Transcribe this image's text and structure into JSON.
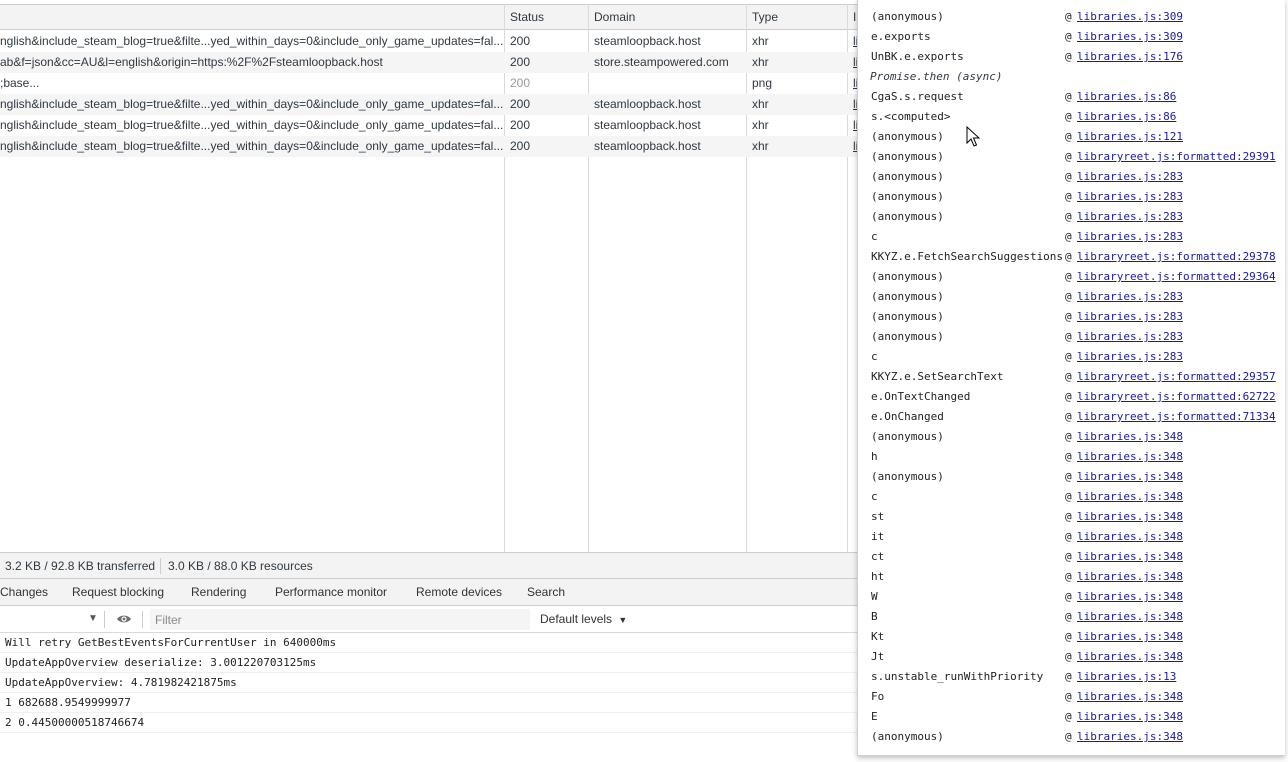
{
  "network": {
    "columns": {
      "status": "Status",
      "domain": "Domain",
      "type": "Type",
      "initiator": "I"
    },
    "rows": [
      {
        "name": "nglish&include_steam_blog=true&filte...yed_within_days=0&include_only_game_updates=fal...",
        "status": "200",
        "domain": "steamloopback.host",
        "type": "xhr",
        "initiator": "li",
        "dim": false
      },
      {
        "name": "ab&f=json&cc=AU&l=english&origin=https:%2F%2Fsteamloopback.host",
        "status": "200",
        "domain": "store.steampowered.com",
        "type": "xhr",
        "initiator": "li",
        "dim": false
      },
      {
        "name": ";base...",
        "status": "200",
        "domain": "",
        "type": "png",
        "initiator": "li",
        "dim": true
      },
      {
        "name": "nglish&include_steam_blog=true&filte...yed_within_days=0&include_only_game_updates=fal...",
        "status": "200",
        "domain": "steamloopback.host",
        "type": "xhr",
        "initiator": "li",
        "dim": false
      },
      {
        "name": "nglish&include_steam_blog=true&filte...yed_within_days=0&include_only_game_updates=fal...",
        "status": "200",
        "domain": "steamloopback.host",
        "type": "xhr",
        "initiator": "li",
        "dim": false
      },
      {
        "name": "nglish&include_steam_blog=true&filte...yed_within_days=0&include_only_game_updates=fal...",
        "status": "200",
        "domain": "steamloopback.host",
        "type": "xhr",
        "initiator": "li",
        "dim": false
      }
    ]
  },
  "summary": {
    "transferred": "3.2 KB / 92.8 KB transferred",
    "resources": "3.0 KB / 88.0 KB resources"
  },
  "drawer_tabs": [
    "Changes",
    "Request blocking",
    "Rendering",
    "Performance monitor",
    "Remote devices",
    "Search"
  ],
  "console": {
    "filter_placeholder": "Filter",
    "levels_label": "Default levels",
    "messages": [
      "Will retry GetBestEventsForCurrentUser in 640000ms",
      "UpdateAppOverview deserialize: 3.001220703125ms",
      "UpdateAppOverview: 4.781982421875ms",
      "1 682688.9549999977",
      "2 0.44500000518746674"
    ]
  },
  "call_stack": {
    "at_symbol": "@",
    "frames": [
      {
        "fn": "(anonymous)",
        "loc": "libraries.js:309"
      },
      {
        "fn": "e.exports",
        "loc": "libraries.js:309"
      },
      {
        "fn": "UnBK.e.exports",
        "loc": "libraries.js:176"
      },
      {
        "async": "Promise.then (async)"
      },
      {
        "fn": "CgaS.s.request",
        "loc": "libraries.js:86"
      },
      {
        "fn": "s.<computed>",
        "loc": "libraries.js:86"
      },
      {
        "fn": "(anonymous)",
        "loc": "libraries.js:121"
      },
      {
        "fn": "(anonymous)",
        "loc": "libraryreet.js:formatted:29391"
      },
      {
        "fn": "(anonymous)",
        "loc": "libraries.js:283"
      },
      {
        "fn": "(anonymous)",
        "loc": "libraries.js:283"
      },
      {
        "fn": "(anonymous)",
        "loc": "libraries.js:283"
      },
      {
        "fn": "c",
        "loc": "libraries.js:283"
      },
      {
        "fn": "KKYZ.e.FetchSearchSuggestions",
        "loc": "libraryreet.js:formatted:29378"
      },
      {
        "fn": "(anonymous)",
        "loc": "libraryreet.js:formatted:29364"
      },
      {
        "fn": "(anonymous)",
        "loc": "libraries.js:283"
      },
      {
        "fn": "(anonymous)",
        "loc": "libraries.js:283"
      },
      {
        "fn": "(anonymous)",
        "loc": "libraries.js:283"
      },
      {
        "fn": "c",
        "loc": "libraries.js:283"
      },
      {
        "fn": "KKYZ.e.SetSearchText",
        "loc": "libraryreet.js:formatted:29357"
      },
      {
        "fn": "e.OnTextChanged",
        "loc": "libraryreet.js:formatted:62722"
      },
      {
        "fn": "e.OnChanged",
        "loc": "libraryreet.js:formatted:71334"
      },
      {
        "fn": "(anonymous)",
        "loc": "libraries.js:348"
      },
      {
        "fn": "h",
        "loc": "libraries.js:348"
      },
      {
        "fn": "(anonymous)",
        "loc": "libraries.js:348"
      },
      {
        "fn": "c",
        "loc": "libraries.js:348"
      },
      {
        "fn": "st",
        "loc": "libraries.js:348"
      },
      {
        "fn": "it",
        "loc": "libraries.js:348"
      },
      {
        "fn": "ct",
        "loc": "libraries.js:348"
      },
      {
        "fn": "ht",
        "loc": "libraries.js:348"
      },
      {
        "fn": "W",
        "loc": "libraries.js:348"
      },
      {
        "fn": "B",
        "loc": "libraries.js:348"
      },
      {
        "fn": "Kt",
        "loc": "libraries.js:348"
      },
      {
        "fn": "Jt",
        "loc": "libraries.js:348"
      },
      {
        "fn": "s.unstable_runWithPriority",
        "loc": "libraries.js:13"
      },
      {
        "fn": "Fo",
        "loc": "libraries.js:348"
      },
      {
        "fn": "E",
        "loc": "libraries.js:348"
      },
      {
        "fn": "(anonymous)",
        "loc": "libraries.js:348"
      }
    ]
  },
  "colors": {
    "link": "#1a1aa6",
    "panel_bg": "#f3f3f3",
    "row_alt": "#f5f5f5"
  }
}
